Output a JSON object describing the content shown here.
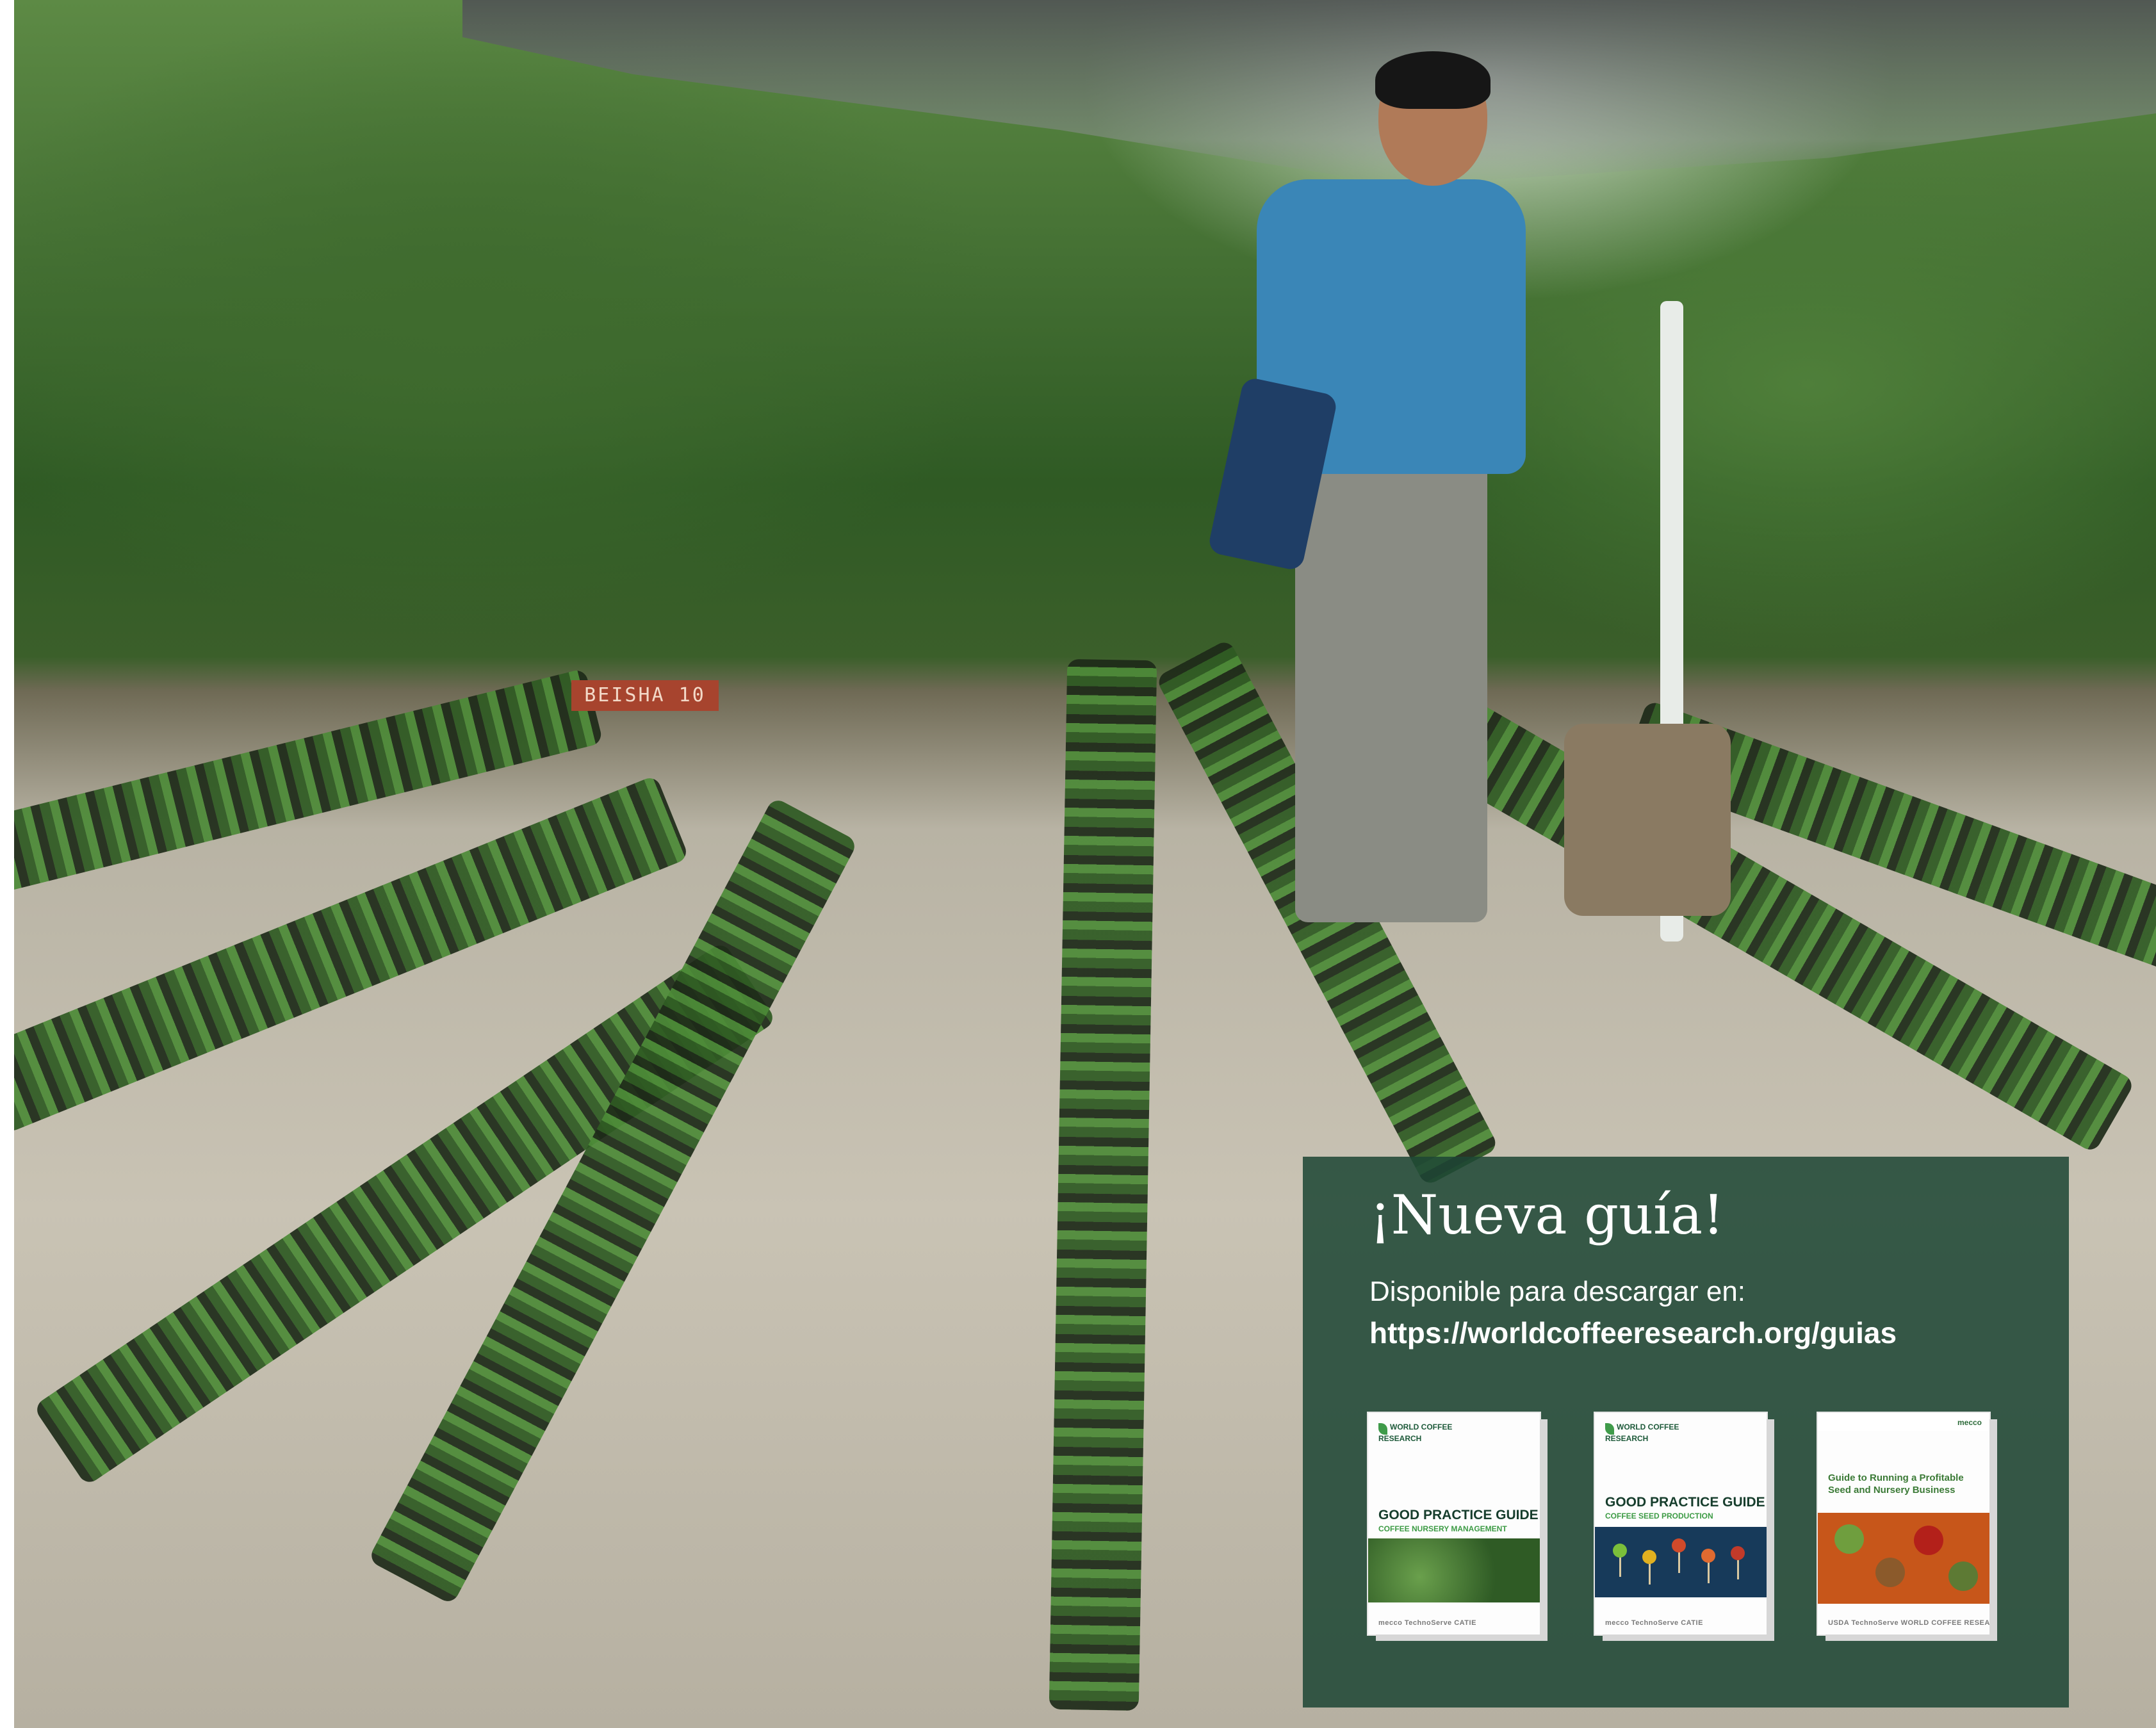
{
  "photo": {
    "sign_text": "BEISHA 10"
  },
  "promo": {
    "title": "¡Nueva guía!",
    "subtitle": "Disponible para descargar en:",
    "url": "https://worldcoffeeresearch.org/guias"
  },
  "books": [
    {
      "publisher": "WORLD COFFEE RESEARCH",
      "title": "GOOD PRACTICE GUIDE",
      "subtitle": "COFFEE NURSERY MANAGEMENT",
      "footer": "mecco   TechnoServe   CATIE"
    },
    {
      "publisher": "WORLD COFFEE RESEARCH",
      "title": "GOOD PRACTICE GUIDE",
      "subtitle": "COFFEE SEED PRODUCTION",
      "footer": "mecco   TechnoServe   CATIE"
    },
    {
      "publisher": "mecco",
      "title": "Guide to Running a Profitable Seed and Nursery Business",
      "footer": "USDA  TechnoServe  WORLD COFFEE RESEARCH  CATIE"
    }
  ],
  "colors": {
    "panel": "#1d4634",
    "accent_green": "#3f9b4a",
    "book3_band": "#c7561a"
  }
}
